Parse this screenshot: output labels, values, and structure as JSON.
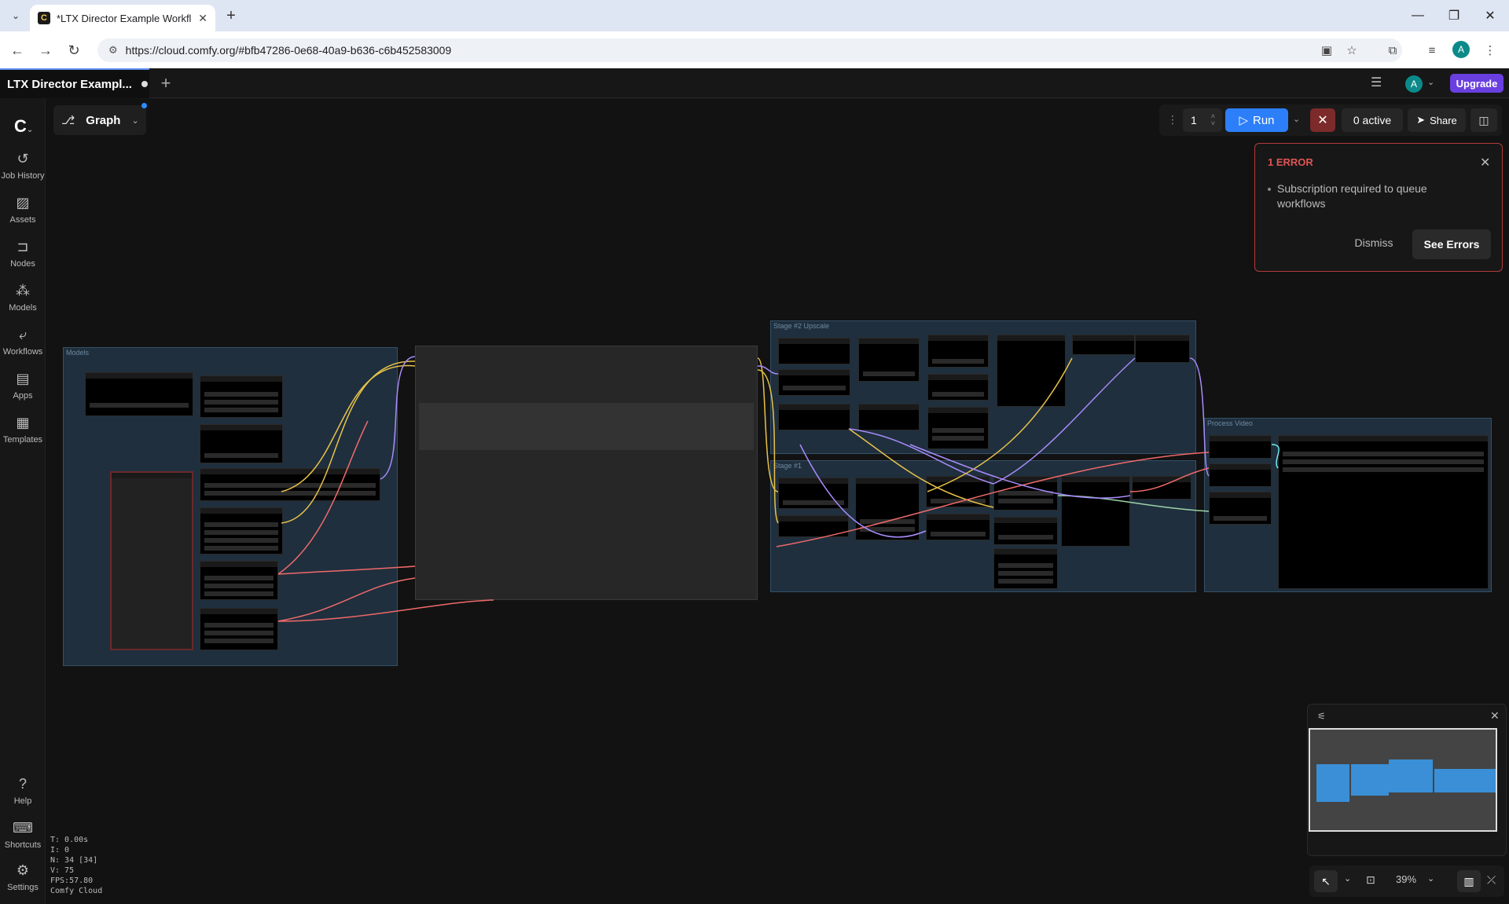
{
  "browser": {
    "tab_title": "*LTX Director Example Workflo",
    "url": "https://cloud.comfy.org/#bfb47286-0e68-40a9-b636-c6b452583009",
    "profile_initial": "A"
  },
  "app": {
    "workflow_tab": "LTX Director Exampl...",
    "avatar_initial": "A",
    "upgrade_label": "Upgrade",
    "graph_label": "Graph"
  },
  "sidebar": {
    "items": [
      {
        "label": "Job History",
        "icon": "history-icon"
      },
      {
        "label": "Assets",
        "icon": "image-icon"
      },
      {
        "label": "Nodes",
        "icon": "node-icon"
      },
      {
        "label": "Models",
        "icon": "models-icon"
      },
      {
        "label": "Workflows",
        "icon": "workflow-icon"
      },
      {
        "label": "Apps",
        "icon": "apps-icon"
      },
      {
        "label": "Templates",
        "icon": "templates-icon"
      }
    ],
    "bottom": [
      {
        "label": "Help",
        "icon": "help-icon"
      },
      {
        "label": "Shortcuts",
        "icon": "keyboard-icon"
      },
      {
        "label": "Settings",
        "icon": "gear-icon"
      }
    ]
  },
  "run_bar": {
    "count": "1",
    "run_label": "Run",
    "active_label": "0 active",
    "share_label": "Share"
  },
  "error_panel": {
    "title": "1 ERROR",
    "message": "Subscription required to queue workflows",
    "dismiss_label": "Dismiss",
    "see_errors_label": "See Errors"
  },
  "groups": {
    "models": "Models",
    "stage2": "Stage #2 Upscale",
    "stage1": "Stage #1",
    "process": "Process Video"
  },
  "zoom": "39%",
  "stats": {
    "t": "T: 0.00s",
    "i": "I: 0",
    "n": "N: 34 [34]",
    "v": "V: 75",
    "fps": "FPS:57.80",
    "brand": "Comfy Cloud"
  }
}
